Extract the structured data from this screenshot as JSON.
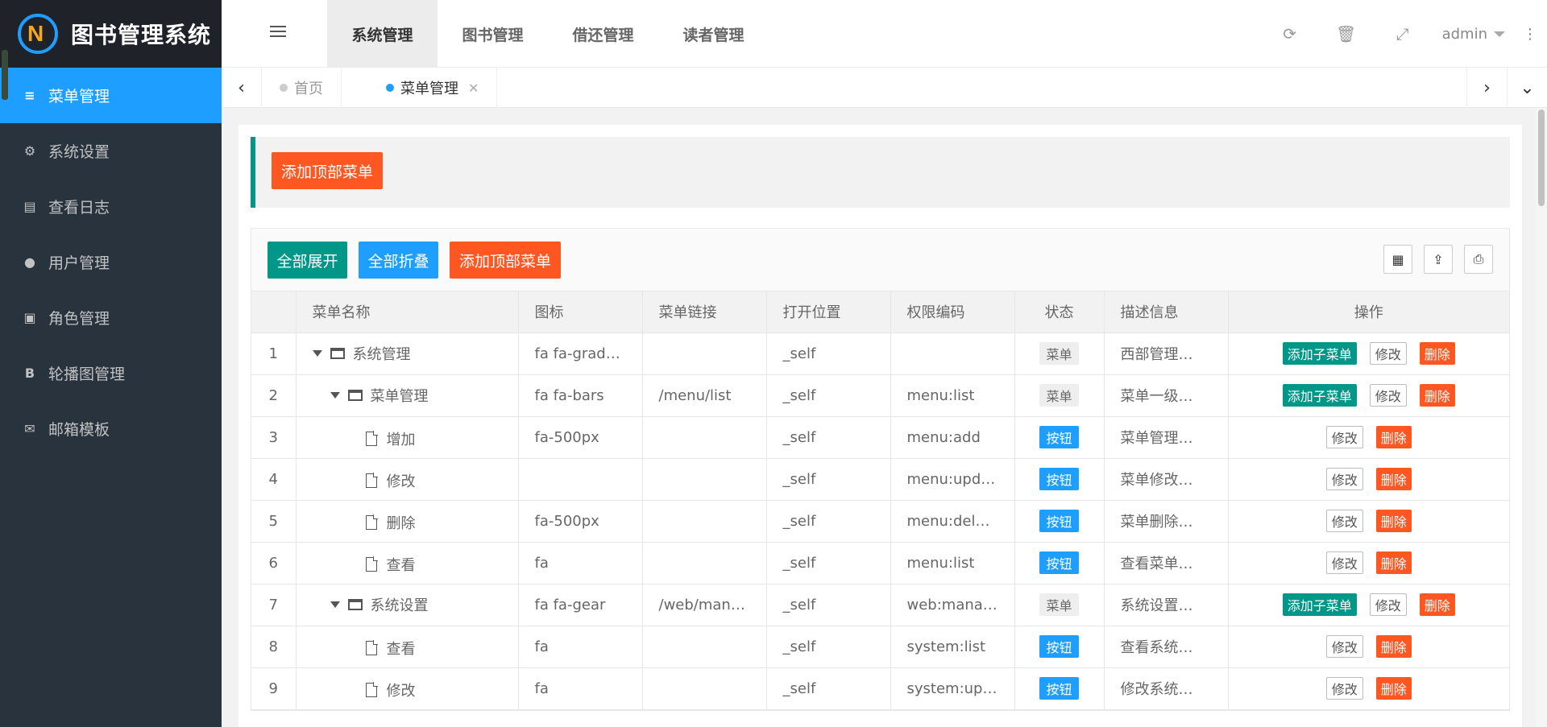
{
  "app": {
    "title": "图书管理系统"
  },
  "sidebar": {
    "items": [
      {
        "icon": "bars-icon",
        "label": "菜单管理",
        "active": true
      },
      {
        "icon": "gear-icon",
        "label": "系统设置"
      },
      {
        "icon": "file-text-icon",
        "label": "查看日志"
      },
      {
        "icon": "user-icon",
        "label": "用户管理"
      },
      {
        "icon": "id-card-icon",
        "label": "角色管理"
      },
      {
        "icon": "bold-b-icon",
        "label": "轮播图管理"
      },
      {
        "icon": "envelope-icon",
        "label": "邮箱模板"
      }
    ]
  },
  "header": {
    "nav": [
      "系统管理",
      "图书管理",
      "借还管理",
      "读者管理"
    ],
    "user": "admin"
  },
  "tabs": {
    "home": "首页",
    "current": "菜单管理"
  },
  "main": {
    "top_add_label": "添加顶部菜单",
    "toolbar": {
      "expand_all": "全部展开",
      "collapse_all": "全部折叠",
      "add_top": "添加顶部菜单"
    },
    "columns": [
      "菜单名称",
      "图标",
      "菜单链接",
      "打开位置",
      "权限编码",
      "状态",
      "描述信息",
      "操作"
    ],
    "rows": [
      {
        "idx": "1",
        "level": 0,
        "type": "folder",
        "name": "系统管理",
        "icon": "fa fa-grad…",
        "link": "",
        "target": "_self",
        "perm": "",
        "status": "菜单",
        "desc": "西部管理…"
      },
      {
        "idx": "2",
        "level": 1,
        "type": "folder",
        "name": "菜单管理",
        "icon": "fa fa-bars",
        "link": "/menu/list",
        "target": "_self",
        "perm": "menu:list",
        "status": "菜单",
        "desc": "菜单一级…"
      },
      {
        "idx": "3",
        "level": 2,
        "type": "file",
        "name": "增加",
        "icon": "fa-500px",
        "link": "",
        "target": "_self",
        "perm": "menu:add",
        "status": "按钮",
        "desc": "菜单管理…"
      },
      {
        "idx": "4",
        "level": 2,
        "type": "file",
        "name": "修改",
        "icon": "",
        "link": "",
        "target": "_self",
        "perm": "menu:upd…",
        "status": "按钮",
        "desc": "菜单修改…"
      },
      {
        "idx": "5",
        "level": 2,
        "type": "file",
        "name": "删除",
        "icon": "fa-500px",
        "link": "",
        "target": "_self",
        "perm": "menu:delete",
        "status": "按钮",
        "desc": "菜单删除…"
      },
      {
        "idx": "6",
        "level": 2,
        "type": "file",
        "name": "查看",
        "icon": "fa",
        "link": "",
        "target": "_self",
        "perm": "menu:list",
        "status": "按钮",
        "desc": "查看菜单…"
      },
      {
        "idx": "7",
        "level": 1,
        "type": "folder",
        "name": "系统设置",
        "icon": "fa fa-gear",
        "link": "/web/man…",
        "target": "_self",
        "perm": "web:manage",
        "status": "菜单",
        "desc": "系统设置…"
      },
      {
        "idx": "8",
        "level": 2,
        "type": "file",
        "name": "查看",
        "icon": "fa",
        "link": "",
        "target": "_self",
        "perm": "system:list",
        "status": "按钮",
        "desc": "查看系统…"
      },
      {
        "idx": "9",
        "level": 2,
        "type": "file",
        "name": "修改",
        "icon": "fa",
        "link": "",
        "target": "_self",
        "perm": "system:up…",
        "status": "按钮",
        "desc": "修改系统…"
      }
    ],
    "ops": {
      "add_child": "添加子菜单",
      "edit": "修改",
      "delete": "删除"
    }
  },
  "colors": {
    "primary": "#1e9fff",
    "green": "#009688",
    "orange": "#ff5722",
    "sidebar": "#28333e"
  }
}
